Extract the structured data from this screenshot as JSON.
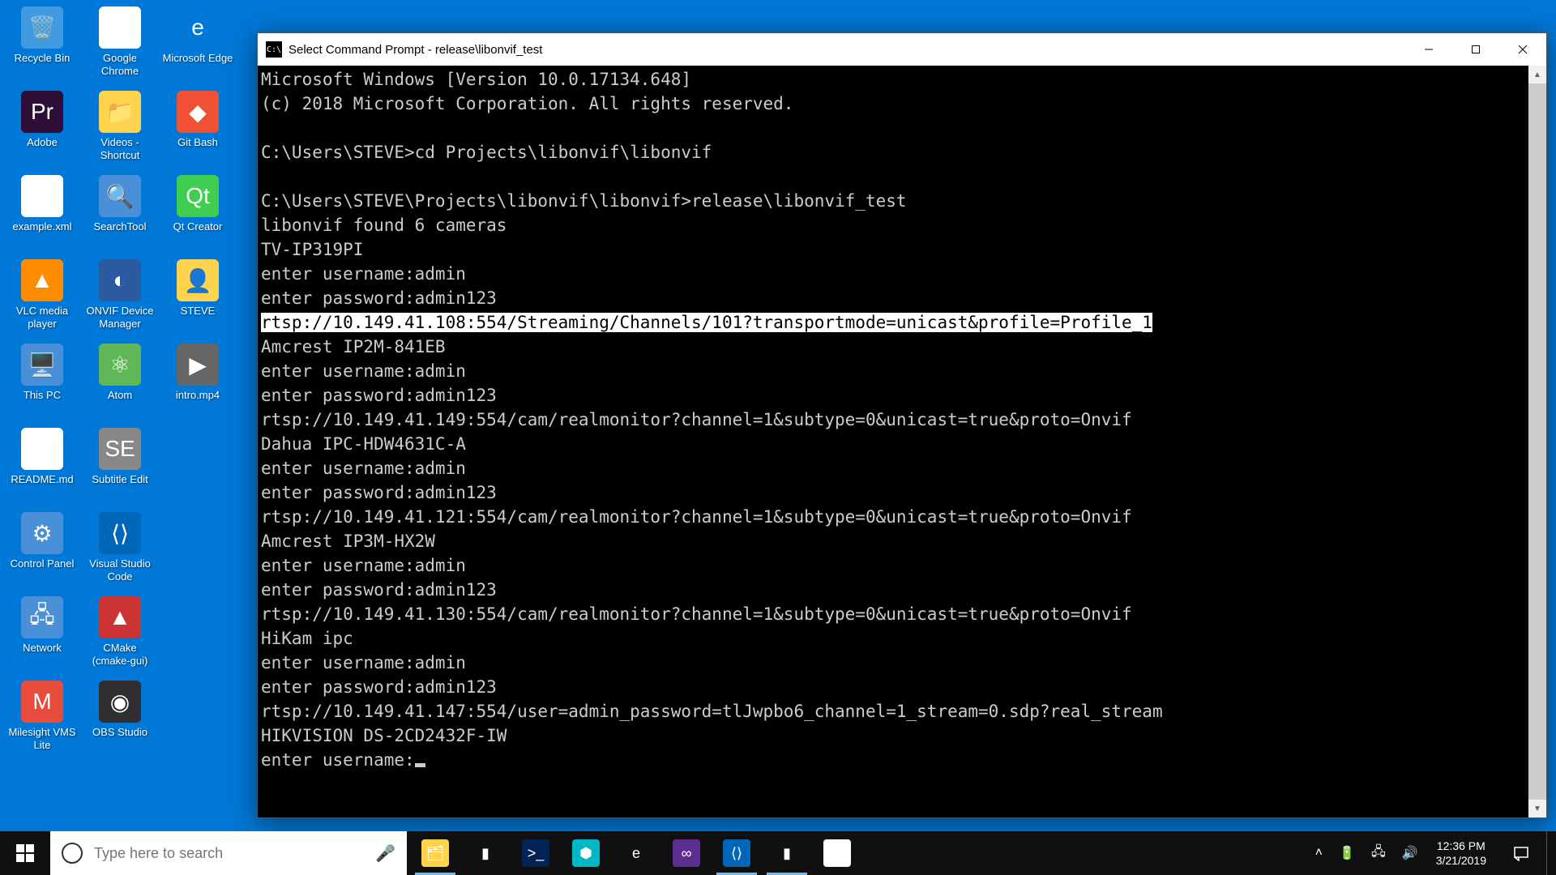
{
  "desktop_icons": [
    {
      "label": "Recycle Bin",
      "bg": "#ffffff40",
      "glyph": "🗑️"
    },
    {
      "label": "Adobe",
      "bg": "#2d0e36",
      "glyph": "Pr"
    },
    {
      "label": "example.xml",
      "bg": "#fff",
      "glyph": "e"
    },
    {
      "label": "VLC media player",
      "bg": "#ff8c00",
      "glyph": "▲"
    },
    {
      "label": "This PC",
      "bg": "#4a90d9",
      "glyph": "🖥️"
    },
    {
      "label": "README.md",
      "bg": "#fff",
      "glyph": "⬇"
    },
    {
      "label": "Control Panel",
      "bg": "#4a90d9",
      "glyph": "⚙"
    },
    {
      "label": "Network",
      "bg": "#4a90d9",
      "glyph": "🖧"
    },
    {
      "label": "Milesight VMS Lite",
      "bg": "#e74c3c",
      "glyph": "M"
    },
    {
      "label": "Google Chrome",
      "bg": "#fff",
      "glyph": "◉"
    },
    {
      "label": "Videos - Shortcut",
      "bg": "#ffd34e",
      "glyph": "📁"
    },
    {
      "label": "SearchTool",
      "bg": "#4a90d9",
      "glyph": "🔍"
    },
    {
      "label": "ONVIF Device Manager",
      "bg": "#2c5aa0",
      "glyph": "◐"
    },
    {
      "label": "Atom",
      "bg": "#5fb757",
      "glyph": "⚛"
    },
    {
      "label": "Subtitle Edit",
      "bg": "#888",
      "glyph": "SE"
    },
    {
      "label": "Visual Studio Code",
      "bg": "#0066b8",
      "glyph": "⟨⟩"
    },
    {
      "label": "CMake (cmake-gui)",
      "bg": "#cc3333",
      "glyph": "▲"
    },
    {
      "label": "OBS Studio",
      "bg": "#302e31",
      "glyph": "◉"
    },
    {
      "label": "Microsoft Edge",
      "bg": "#0078d7",
      "glyph": "e"
    },
    {
      "label": "Git Bash",
      "bg": "#f05033",
      "glyph": "◆"
    },
    {
      "label": "Qt Creator",
      "bg": "#41cd52",
      "glyph": "Qt"
    },
    {
      "label": "STEVE",
      "bg": "#ffd34e",
      "glyph": "👤"
    },
    {
      "label": "intro.mp4",
      "bg": "#666",
      "glyph": "▶"
    }
  ],
  "window": {
    "title": "Select Command Prompt - release\\libonvif_test"
  },
  "terminal_lines": [
    {
      "text": "Microsoft Windows [Version 10.0.17134.648]"
    },
    {
      "text": "(c) 2018 Microsoft Corporation. All rights reserved."
    },
    {
      "text": ""
    },
    {
      "text": "C:\\Users\\STEVE>cd Projects\\libonvif\\libonvif"
    },
    {
      "text": ""
    },
    {
      "text": "C:\\Users\\STEVE\\Projects\\libonvif\\libonvif>release\\libonvif_test"
    },
    {
      "text": "libonvif found 6 cameras"
    },
    {
      "text": "TV-IP319PI"
    },
    {
      "text": "enter username:admin"
    },
    {
      "text": "enter password:admin123"
    },
    {
      "text": "rtsp://10.149.41.108:554/Streaming/Channels/101?transportmode=unicast&profile=Profile_1",
      "highlighted": true
    },
    {
      "text": "Amcrest IP2M-841EB"
    },
    {
      "text": "enter username:admin"
    },
    {
      "text": "enter password:admin123"
    },
    {
      "text": "rtsp://10.149.41.149:554/cam/realmonitor?channel=1&subtype=0&unicast=true&proto=Onvif"
    },
    {
      "text": "Dahua IPC-HDW4631C-A"
    },
    {
      "text": "enter username:admin"
    },
    {
      "text": "enter password:admin123"
    },
    {
      "text": "rtsp://10.149.41.121:554/cam/realmonitor?channel=1&subtype=0&unicast=true&proto=Onvif"
    },
    {
      "text": "Amcrest IP3M-HX2W"
    },
    {
      "text": "enter username:admin"
    },
    {
      "text": "enter password:admin123"
    },
    {
      "text": "rtsp://10.149.41.130:554/cam/realmonitor?channel=1&subtype=0&unicast=true&proto=Onvif"
    },
    {
      "text": "HiKam ipc"
    },
    {
      "text": "enter username:admin"
    },
    {
      "text": "enter password:admin123"
    },
    {
      "text": "rtsp://10.149.41.147:554/user=admin_password=tlJwpbo6_channel=1_stream=0.sdp?real_stream"
    },
    {
      "text": "HIKVISION DS-2CD2432F-IW"
    },
    {
      "text": "enter username:",
      "cursor": true
    }
  ],
  "search": {
    "placeholder": "Type here to search"
  },
  "taskbar_apps": [
    {
      "name": "file-explorer",
      "bg": "#ffd34e",
      "glyph": "🗂",
      "active": true
    },
    {
      "name": "cmd",
      "bg": "#111",
      "glyph": "▮",
      "active": false
    },
    {
      "name": "powershell",
      "bg": "#012456",
      "glyph": ">_",
      "active": false
    },
    {
      "name": "store",
      "bg": "#00b7c3",
      "glyph": "⬢",
      "active": false
    },
    {
      "name": "ie",
      "bg": "transparent",
      "glyph": "e",
      "active": false
    },
    {
      "name": "visual-studio",
      "bg": "#5c2d91",
      "glyph": "∞",
      "active": false
    },
    {
      "name": "vscode",
      "bg": "#0066b8",
      "glyph": "⟨⟩",
      "active": true
    },
    {
      "name": "cmd-running",
      "bg": "#111",
      "glyph": "▮",
      "active": true
    },
    {
      "name": "chrome",
      "bg": "#fff",
      "glyph": "◉",
      "active": false
    }
  ],
  "clock": {
    "time": "12:36 PM",
    "date": "3/21/2019"
  }
}
